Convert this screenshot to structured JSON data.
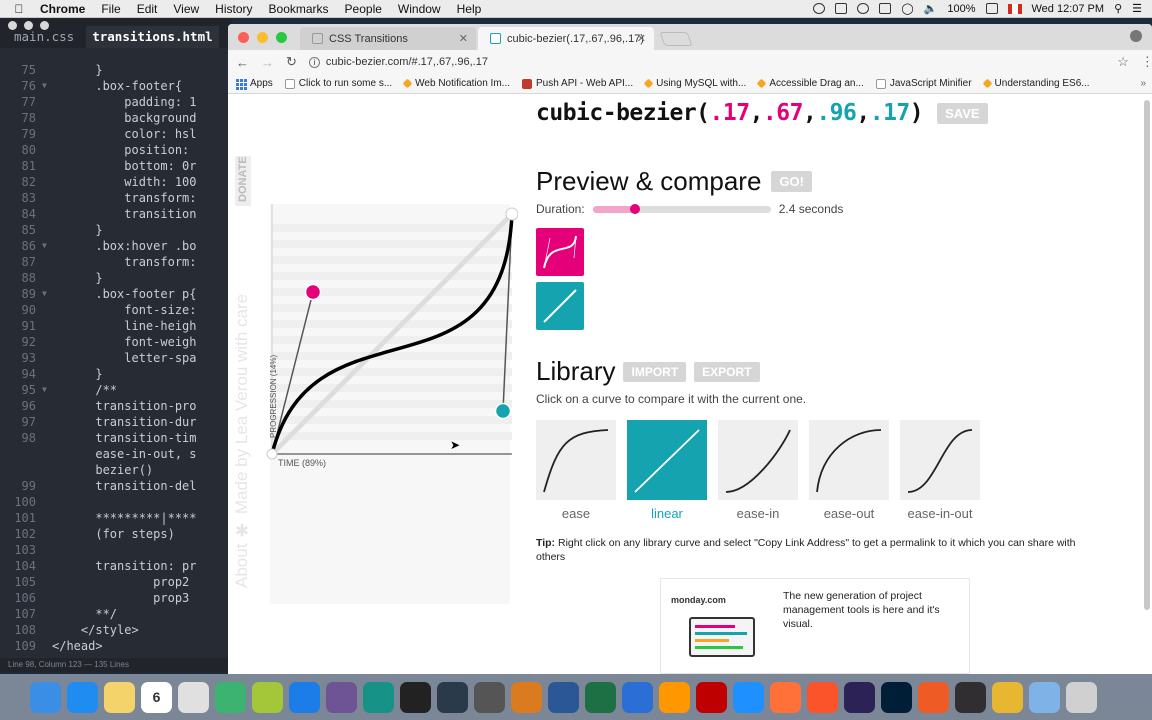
{
  "menubar": {
    "app": "Chrome",
    "items": [
      "File",
      "Edit",
      "View",
      "History",
      "Bookmarks",
      "People",
      "Window",
      "Help"
    ],
    "battery": "100%",
    "clock": "Wed 12:07 PM"
  },
  "editor": {
    "tabs": [
      "main.css",
      "transitions.html"
    ],
    "status": "Line 98, Column 123 — 135 Lines",
    "lines": [
      {
        "num": "75",
        "fold": "",
        "code": "      }"
      },
      {
        "num": "76",
        "fold": "▼",
        "code": "      .box-footer{"
      },
      {
        "num": "77",
        "fold": "",
        "code": "          padding: 1"
      },
      {
        "num": "78",
        "fold": "",
        "code": "          background"
      },
      {
        "num": "79",
        "fold": "",
        "code": "          color: hsl"
      },
      {
        "num": "80",
        "fold": "",
        "code": "          position:"
      },
      {
        "num": "81",
        "fold": "",
        "code": "          bottom: 0r"
      },
      {
        "num": "82",
        "fold": "",
        "code": "          width: 100"
      },
      {
        "num": "83",
        "fold": "",
        "code": "          transform:"
      },
      {
        "num": "84",
        "fold": "",
        "code": "          transition"
      },
      {
        "num": "85",
        "fold": "",
        "code": "      }"
      },
      {
        "num": "86",
        "fold": "▼",
        "code": "      .box:hover .bo"
      },
      {
        "num": "87",
        "fold": "",
        "code": "          transform:"
      },
      {
        "num": "88",
        "fold": "",
        "code": "      }"
      },
      {
        "num": "89",
        "fold": "▼",
        "code": "      .box-footer p{"
      },
      {
        "num": "90",
        "fold": "",
        "code": "          font-size:"
      },
      {
        "num": "91",
        "fold": "",
        "code": "          line-heigh"
      },
      {
        "num": "92",
        "fold": "",
        "code": "          font-weigh"
      },
      {
        "num": "93",
        "fold": "",
        "code": "          letter-spa"
      },
      {
        "num": "94",
        "fold": "",
        "code": "      }"
      },
      {
        "num": "95",
        "fold": "▼",
        "code": "      /**"
      },
      {
        "num": "96",
        "fold": "",
        "code": "      transition-pro"
      },
      {
        "num": "97",
        "fold": "",
        "code": "      transition-dur"
      },
      {
        "num": "98",
        "fold": "",
        "code": "      transition-tim"
      },
      {
        "num": "",
        "fold": "",
        "code": "      ease-in-out, s"
      },
      {
        "num": "",
        "fold": "",
        "code": "      bezier()"
      },
      {
        "num": "99",
        "fold": "",
        "code": "      transition-del"
      },
      {
        "num": "100",
        "fold": "",
        "code": ""
      },
      {
        "num": "101",
        "fold": "",
        "code": "      *********|****"
      },
      {
        "num": "102",
        "fold": "",
        "code": "      (for steps)"
      },
      {
        "num": "103",
        "fold": "",
        "code": ""
      },
      {
        "num": "104",
        "fold": "",
        "code": "      transition: pr"
      },
      {
        "num": "105",
        "fold": "",
        "code": "              prop2"
      },
      {
        "num": "106",
        "fold": "",
        "code": "              prop3"
      },
      {
        "num": "107",
        "fold": "",
        "code": "      **/"
      },
      {
        "num": "108",
        "fold": "",
        "code": "    </style>"
      },
      {
        "num": "109",
        "fold": "",
        "code": "</head>"
      }
    ]
  },
  "browser": {
    "tabs": [
      {
        "title": "CSS Transitions"
      },
      {
        "title": "cubic-bezier(.17,.67,.96,.17)"
      }
    ],
    "url": "cubic-bezier.com/#.17,.67,.96,.17",
    "bookmarks": [
      "Apps",
      "Click to run some s...",
      "Web Notification Im...",
      "Push API - Web API...",
      "Using MySQL with...",
      "Accessible Drag an...",
      "JavaScript Minifier",
      "Understanding ES6..."
    ]
  },
  "page": {
    "donate": "DONATE",
    "sidebar_about": "About",
    "sidebar_made": "Made by Lea Verou with care",
    "progression_label": "PROGRESSION (14%)",
    "time_label": "TIME (89%)",
    "title_prefix": "cubic-bezier(",
    "p1": ".17",
    "p2": ".67",
    "p3": ".96",
    "p4": ".17",
    "title_suffix": ")",
    "save": "SAVE",
    "preview_heading": "Preview & compare",
    "go": "GO!",
    "duration_label": "Duration:",
    "duration_value": "2.4 seconds",
    "duration_fraction": 0.24,
    "library_heading": "Library",
    "import": "IMPORT",
    "export": "EXPORT",
    "library_desc": "Click on a curve to compare it with the current one.",
    "library": [
      {
        "name": "ease",
        "active": false
      },
      {
        "name": "linear",
        "active": true
      },
      {
        "name": "ease-in",
        "active": false
      },
      {
        "name": "ease-out",
        "active": false
      },
      {
        "name": "ease-in-out",
        "active": false
      }
    ],
    "tip_label": "Tip:",
    "tip_text": "Right click on any library curve and select \"Copy Link Address\" to get a permalink to it which you can share with others",
    "ad_brand": "monday.com",
    "ad_text": "The new generation of project management tools is here and it's visual.",
    "colors": {
      "pink": "#e5007a",
      "teal": "#15a3b0"
    }
  },
  "dock": {
    "icons": [
      "finder-icon",
      "app-store-icon",
      "notes-icon",
      "calendar-icon",
      "chrome-icon",
      "leaf-icon",
      "android-studio-icon",
      "xcode-icon",
      "github-icon",
      "gitkraken-icon",
      "terminal-icon",
      "brackets-icon",
      "calculator-icon",
      "sequel-pro-icon",
      "word-icon",
      "excel-icon",
      "keynote-icon",
      "sublime-icon",
      "filezilla-icon",
      "safari-icon",
      "firefox-icon",
      "brave-icon",
      "eclipse-icon",
      "photoshop-icon",
      "postman-icon",
      "obs-icon",
      "chrome-canary-icon",
      "downloads-icon",
      "trash-icon"
    ],
    "calendar_day": "6"
  }
}
